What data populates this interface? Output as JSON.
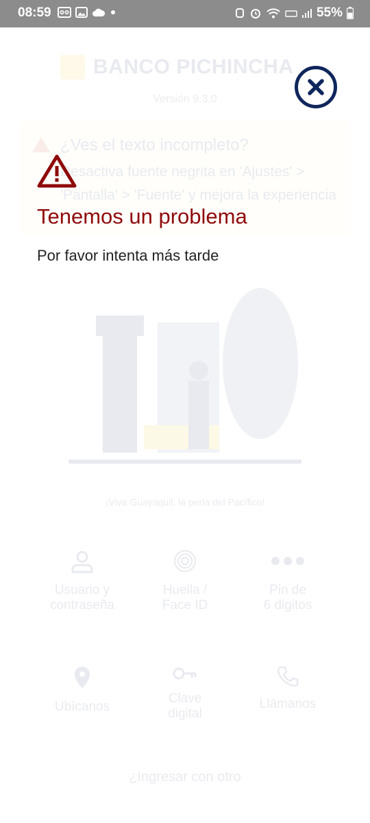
{
  "status_bar": {
    "time": "08:59",
    "battery_percent": "55%"
  },
  "background": {
    "brand_name": "BANCO PICHINCHA",
    "version": "Versión 9.3.0",
    "notice": {
      "title": "¿Ves el texto incompleto?",
      "body": "Desactiva fuente negrita en 'Ajustes' > 'Pantalla' > 'Fuente' y mejora la experiencia"
    },
    "caption": "¡Viva Guayaquil, la perla del Pacífico!",
    "options": [
      {
        "line1": "Usuario y",
        "line2": "contraseña",
        "icon": "user-icon"
      },
      {
        "line1": "Huella /",
        "line2": "Face ID",
        "icon": "fingerprint-icon"
      },
      {
        "line1": "Pin de",
        "line2": "6 digitos",
        "icon": "dots-icon"
      },
      {
        "line1": "Ubícanos",
        "line2": "",
        "icon": "location-pin-icon"
      },
      {
        "line1": "Clave",
        "line2": "digital",
        "icon": "key-icon"
      },
      {
        "line1": "Llámanos",
        "line2": "",
        "icon": "phone-icon"
      }
    ],
    "other_login": "¿Ingresar con otro"
  },
  "dialog": {
    "title": "Tenemos un problema",
    "message": "Por favor intenta más tarde",
    "icon": "warning-icon",
    "close_icon": "close-icon"
  },
  "colors": {
    "primary": "#0f265c",
    "error": "#8f0a0a",
    "status_bar": "#8c8c8c"
  }
}
